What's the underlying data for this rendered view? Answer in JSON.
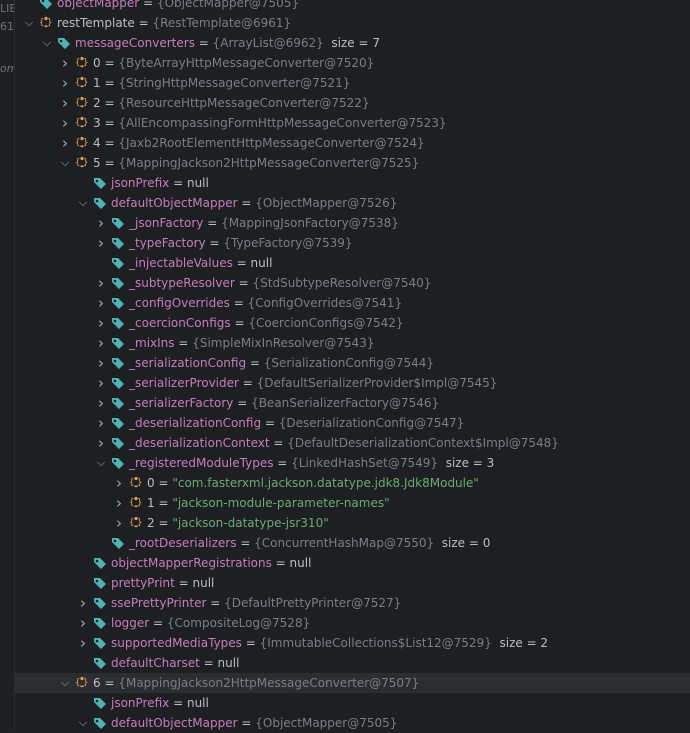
{
  "gutter": [
    "LIB",
    "61",
    "om"
  ],
  "rows": [
    {
      "depth": 1,
      "arrow": "none",
      "icon": "field-icon",
      "name": "objectMapper",
      "type": "{ObjectMapper@7505}"
    },
    {
      "depth": 1,
      "arrow": "down",
      "icon": "object-icon",
      "name": "restTemplate",
      "type": "{RestTemplate@6961}"
    },
    {
      "depth": 2,
      "arrow": "down",
      "icon": "field-icon",
      "name": "messageConverters",
      "type": "{ArrayList@6962}",
      "extra": "size = 7"
    },
    {
      "depth": 3,
      "arrow": "right",
      "icon": "object-icon",
      "name": "0",
      "type": "{ByteArrayHttpMessageConverter@7520}"
    },
    {
      "depth": 3,
      "arrow": "right",
      "icon": "object-icon",
      "name": "1",
      "type": "{StringHttpMessageConverter@7521}"
    },
    {
      "depth": 3,
      "arrow": "right",
      "icon": "object-icon",
      "name": "2",
      "type": "{ResourceHttpMessageConverter@7522}"
    },
    {
      "depth": 3,
      "arrow": "right",
      "icon": "object-icon",
      "name": "3",
      "type": "{AllEncompassingFormHttpMessageConverter@7523}"
    },
    {
      "depth": 3,
      "arrow": "right",
      "icon": "object-icon",
      "name": "4",
      "type": "{Jaxb2RootElementHttpMessageConverter@7524}"
    },
    {
      "depth": 3,
      "arrow": "down",
      "icon": "object-icon",
      "name": "5",
      "type": "{MappingJackson2HttpMessageConverter@7525}"
    },
    {
      "depth": 4,
      "arrow": "none",
      "icon": "field-icon",
      "name": "jsonPrefix",
      "null": "null"
    },
    {
      "depth": 4,
      "arrow": "down",
      "icon": "field-icon",
      "name": "defaultObjectMapper",
      "type": "{ObjectMapper@7526}"
    },
    {
      "depth": 5,
      "arrow": "right",
      "icon": "field-icon",
      "name": "_jsonFactory",
      "type": "{MappingJsonFactory@7538}"
    },
    {
      "depth": 5,
      "arrow": "right",
      "icon": "field-icon",
      "name": "_typeFactory",
      "type": "{TypeFactory@7539}"
    },
    {
      "depth": 5,
      "arrow": "none",
      "icon": "field-icon",
      "name": "_injectableValues",
      "null": "null"
    },
    {
      "depth": 5,
      "arrow": "right",
      "icon": "field-icon",
      "name": "_subtypeResolver",
      "type": "{StdSubtypeResolver@7540}"
    },
    {
      "depth": 5,
      "arrow": "right",
      "icon": "field-icon",
      "name": "_configOverrides",
      "type": "{ConfigOverrides@7541}"
    },
    {
      "depth": 5,
      "arrow": "right",
      "icon": "field-icon",
      "name": "_coercionConfigs",
      "type": "{CoercionConfigs@7542}"
    },
    {
      "depth": 5,
      "arrow": "right",
      "icon": "field-icon",
      "name": "_mixIns",
      "type": "{SimpleMixInResolver@7543}"
    },
    {
      "depth": 5,
      "arrow": "right",
      "icon": "field-icon",
      "name": "_serializationConfig",
      "type": "{SerializationConfig@7544}"
    },
    {
      "depth": 5,
      "arrow": "right",
      "icon": "field-icon",
      "name": "_serializerProvider",
      "type": "{DefaultSerializerProvider$Impl@7545}"
    },
    {
      "depth": 5,
      "arrow": "right",
      "icon": "field-icon",
      "name": "_serializerFactory",
      "type": "{BeanSerializerFactory@7546}"
    },
    {
      "depth": 5,
      "arrow": "right",
      "icon": "field-icon",
      "name": "_deserializationConfig",
      "type": "{DeserializationConfig@7547}"
    },
    {
      "depth": 5,
      "arrow": "right",
      "icon": "field-icon",
      "name": "_deserializationContext",
      "type": "{DefaultDeserializationContext$Impl@7548}"
    },
    {
      "depth": 5,
      "arrow": "down",
      "icon": "field-icon",
      "name": "_registeredModuleTypes",
      "type": "{LinkedHashSet@7549}",
      "extra": "size = 3"
    },
    {
      "depth": 6,
      "arrow": "right",
      "icon": "object-icon",
      "name": "0",
      "str": "\"com.fasterxml.jackson.datatype.jdk8.Jdk8Module\""
    },
    {
      "depth": 6,
      "arrow": "right",
      "icon": "object-icon",
      "name": "1",
      "str": "\"jackson-module-parameter-names\""
    },
    {
      "depth": 6,
      "arrow": "right",
      "icon": "object-icon",
      "name": "2",
      "str": "\"jackson-datatype-jsr310\""
    },
    {
      "depth": 5,
      "arrow": "none",
      "icon": "field-icon",
      "name": "_rootDeserializers",
      "type": "{ConcurrentHashMap@7550}",
      "extra": "size = 0"
    },
    {
      "depth": 4,
      "arrow": "none",
      "icon": "field-icon",
      "name": "objectMapperRegistrations",
      "null": "null"
    },
    {
      "depth": 4,
      "arrow": "none",
      "icon": "field-icon",
      "name": "prettyPrint",
      "null": "null"
    },
    {
      "depth": 4,
      "arrow": "right",
      "icon": "field-icon",
      "name": "ssePrettyPrinter",
      "type": "{DefaultPrettyPrinter@7527}"
    },
    {
      "depth": 4,
      "arrow": "right",
      "icon": "field-icon",
      "name": "logger",
      "type": "{CompositeLog@7528}"
    },
    {
      "depth": 4,
      "arrow": "right",
      "icon": "field-icon",
      "name": "supportedMediaTypes",
      "type": "{ImmutableCollections$List12@7529}",
      "extra": "size = 2"
    },
    {
      "depth": 4,
      "arrow": "none",
      "icon": "field-icon",
      "name": "defaultCharset",
      "null": "null"
    },
    {
      "depth": 3,
      "arrow": "down",
      "icon": "object-icon",
      "name": "6",
      "type": "{MappingJackson2HttpMessageConverter@7507}",
      "selected": true
    },
    {
      "depth": 4,
      "arrow": "none",
      "icon": "field-icon",
      "name": "jsonPrefix",
      "null": "null"
    },
    {
      "depth": 4,
      "arrow": "down",
      "icon": "field-icon",
      "name": "defaultObjectMapper",
      "type": "{ObjectMapper@7505}"
    }
  ],
  "labels": {
    "eq": " = "
  },
  "colors": {
    "field": "#c77dbb",
    "object": "#e0a35a",
    "string": "#6aab73",
    "tag": "#4fb3b3"
  }
}
